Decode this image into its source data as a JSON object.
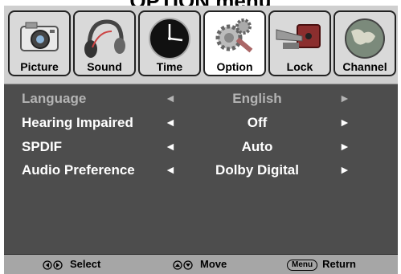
{
  "title": "OPTION menu",
  "tabs": [
    {
      "label": "Picture",
      "icon": "camera-icon",
      "active": false
    },
    {
      "label": "Sound",
      "icon": "headphones-icon",
      "active": false
    },
    {
      "label": "Time",
      "icon": "clock-icon",
      "active": false
    },
    {
      "label": "Option",
      "icon": "gear-icon",
      "active": true
    },
    {
      "label": "Lock",
      "icon": "lock-icon",
      "active": false
    },
    {
      "label": "Channel",
      "icon": "globe-icon",
      "active": false
    }
  ],
  "settings": [
    {
      "label": "Language",
      "value": "English",
      "highlighted": true
    },
    {
      "label": "Hearing Impaired",
      "value": "Off",
      "highlighted": false
    },
    {
      "label": "SPDIF",
      "value": "Auto",
      "highlighted": false
    },
    {
      "label": "Audio Preference",
      "value": "Dolby Digital",
      "highlighted": false
    }
  ],
  "arrows": {
    "left": "◄",
    "right": "►"
  },
  "footer": {
    "select_label": "Select",
    "move_label": "Move",
    "menu_key": "Menu",
    "return_label": "Return"
  },
  "colors": {
    "panel": "#4d4d4d",
    "tabbar": "#cfcfcf",
    "footer": "#a6a6a6",
    "highlight_text": "#b4b4b4"
  }
}
